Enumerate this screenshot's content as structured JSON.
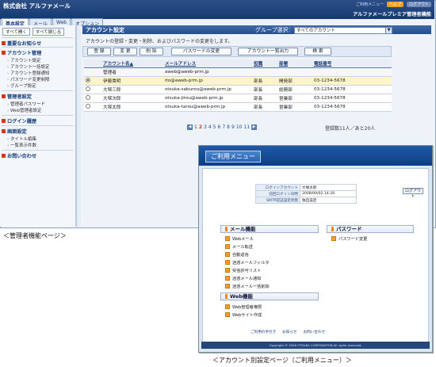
{
  "admin": {
    "company": "株式会社 アルファメール",
    "links": [
      "ご利用メニュー",
      "ヘルプ",
      "ログアウト"
    ],
    "system_name": "アルファメールプレミア管理者機能",
    "tabs": [
      "基本設定",
      "メール",
      "Web",
      "オプション"
    ],
    "sidebar": {
      "buttons": [
        "すべて開く",
        "すべて閉じる"
      ],
      "sections": [
        {
          "title": "重要なお知らせ",
          "items": []
        },
        {
          "title": "アカウント管理",
          "items": [
            "アカウント設定",
            "アカウント一括設定",
            "アカウント登録通知",
            "パスワード変更制限",
            "グループ設定"
          ]
        },
        {
          "title": "管理者設定",
          "items": [
            "管理者パスワード",
            "Web管理者設定"
          ]
        },
        {
          "title": "ログイン履歴",
          "items": []
        },
        {
          "title": "画面設定",
          "items": [
            "タイトル編集",
            "一覧表示件数"
          ]
        },
        {
          "title": "お問い合わせ",
          "items": []
        }
      ]
    },
    "main": {
      "title": "アカウント設定",
      "group_label": "グループ選択：",
      "group_value": "すべてのアカウント",
      "description": "アカウントの登録・変更・削除、およびパスワードの変更をします。",
      "buttons": [
        "登 録",
        "変 更",
        "削 除",
        "パスワードの変更",
        "アカウント一覧出力",
        "検 索"
      ],
      "columns": [
        "アカウント名▲",
        "メールアドレス",
        "役職",
        "部署",
        "電話番号"
      ],
      "rows": [
        {
          "name": "管理者",
          "email": "aweb@aweb-prm.jp",
          "title": "",
          "dept": "",
          "phone": ""
        },
        {
          "name": "伊藤貴明",
          "email": "ito@aweb-prm.jp",
          "title": "部長",
          "dept": "開発部",
          "phone": "03-1234-5678"
        },
        {
          "name": "大塚三郎",
          "email": "otsuka-saburou@aweb-prm.jp",
          "title": "部長",
          "dept": "総務部",
          "phone": "03-1234-5678"
        },
        {
          "name": "大塚次郎",
          "email": "otsuka-jirou@aweb-prm.jp",
          "title": "部長",
          "dept": "営業部",
          "phone": "03-1234-5678"
        },
        {
          "name": "大塚太郎",
          "email": "otsuka-tarou@aweb-prm.jp",
          "title": "部長",
          "dept": "営業部",
          "phone": "03-1234-5678"
        }
      ],
      "pages": [
        "1",
        "2",
        "3",
        "4",
        "5",
        "6",
        "7",
        "8",
        "9",
        "10",
        "11"
      ],
      "current_page": "2",
      "count_text": "登録数11人／あと20人"
    }
  },
  "admin_caption": "＜管理者機能ページ＞",
  "user_menu": {
    "title": "ご利用メニュー",
    "logout": "ログアウト",
    "info": [
      {
        "label": "ログインアカウント",
        "value": "大塚太郎"
      },
      {
        "label": "前回ログイン日時",
        "value": "2008/09/02 14:26"
      },
      {
        "label": "SMTP認証設定状態",
        "value": "独自設定"
      }
    ],
    "mail_heading": "メール機能",
    "mail_items": [
      "Webメール",
      "メール転送",
      "自動返信",
      "迷惑メールフィルタ",
      "受信許可リスト",
      "迷惑メール通知",
      "迷惑メールー括削除"
    ],
    "web_heading": "Web機能",
    "web_items": [
      "Web管理者権限",
      "Webサイト作成"
    ],
    "pw_heading": "パスワード",
    "pw_items": [
      "パスワード変更"
    ],
    "footer_links": [
      "ご利用の手引き",
      "お知らせ",
      "お問い合わせ"
    ],
    "copyright": "Copyright © 2008 OTSUKA CORPORATION All rights reserved."
  },
  "user_caption": "＜アカウント別設定ページ（ご利用メニュー）＞"
}
